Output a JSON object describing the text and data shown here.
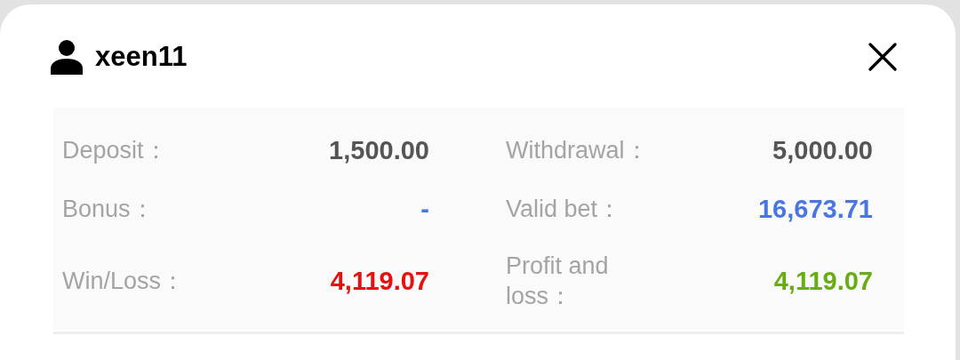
{
  "header": {
    "username": "xeen11"
  },
  "stats": [
    {
      "label": "Deposit：",
      "value": "1,500.00",
      "color": "#555555"
    },
    {
      "label": "Bonus：",
      "value": "-",
      "color": "#4a76e0"
    },
    {
      "label": "Win/Loss：",
      "value": "4,119.07",
      "color": "#e8100f"
    },
    {
      "label": "Withdrawal：",
      "value": "5,000.00",
      "color": "#555555"
    },
    {
      "label": "Valid bet：",
      "value": "16,673.71",
      "color": "#4a76e0"
    },
    {
      "label": "Profit and loss：",
      "value": "4,119.07",
      "color": "#6aac14"
    }
  ]
}
